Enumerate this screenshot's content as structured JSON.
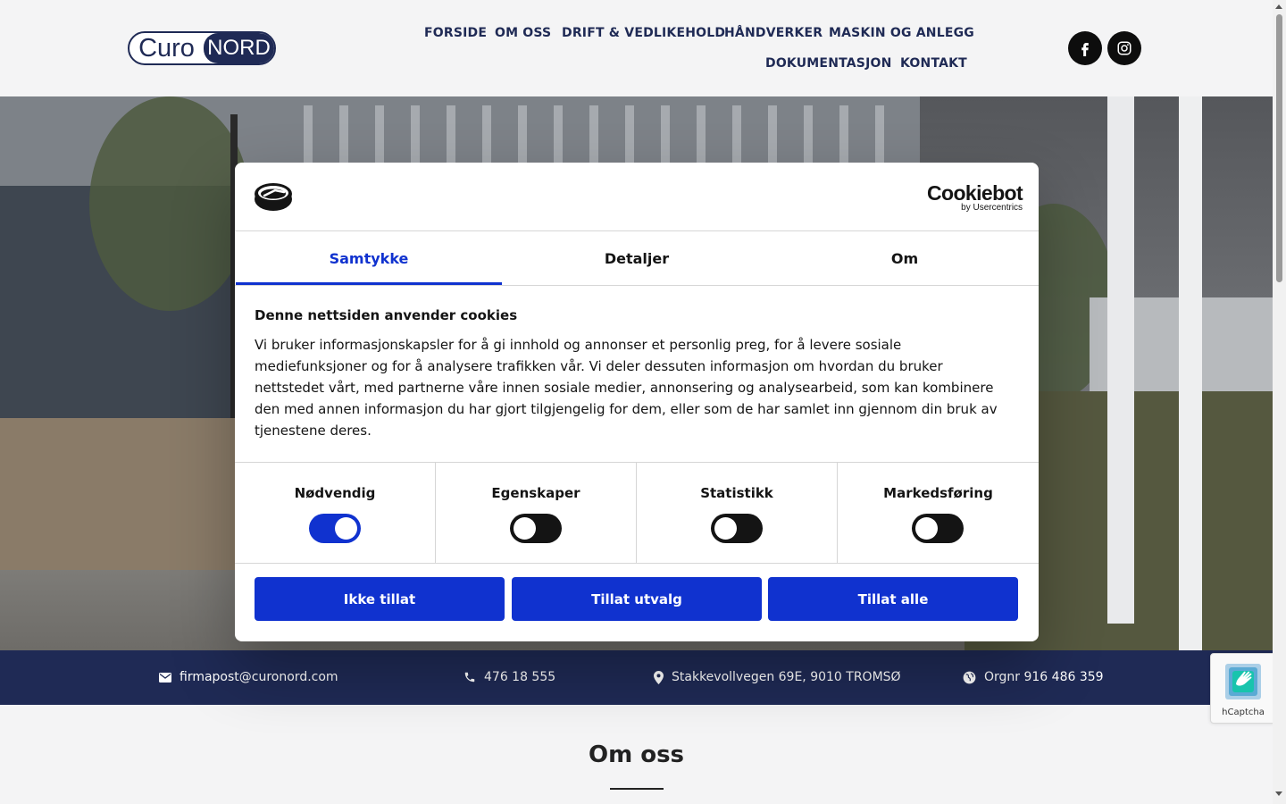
{
  "header": {
    "logo": {
      "part1": "Curo",
      "part2": "NORD"
    },
    "nav": [
      {
        "label": "FORSIDE"
      },
      {
        "label": "OM OSS"
      },
      {
        "label": "DRIFT & VEDLIKEHOLD"
      },
      {
        "label": "HÅNDVERKER"
      },
      {
        "label": "MASKIN OG ANLEGG"
      },
      {
        "label": "DOKUMENTASJON"
      },
      {
        "label": "KONTAKT"
      }
    ],
    "social": [
      {
        "icon": "facebook-icon"
      },
      {
        "icon": "instagram-icon"
      }
    ]
  },
  "infobar": {
    "email": "firmapost@curonord.com",
    "phone": "476 18 555",
    "address": "Stakkevollvegen 69E, 9010 TROMSØ",
    "orgnr": "Orgnr 916 486 359"
  },
  "section": {
    "title": "Om oss"
  },
  "hcaptcha": {
    "label": "hCaptcha"
  },
  "cookie_dialog": {
    "brand": {
      "name": "Cookiebot",
      "by": "by Usercentrics"
    },
    "tabs": [
      {
        "label": "Samtykke",
        "active": true
      },
      {
        "label": "Detaljer",
        "active": false
      },
      {
        "label": "Om",
        "active": false
      }
    ],
    "heading": "Denne nettsiden anvender cookies",
    "body": "Vi bruker informasjonskapsler for å gi innhold og annonser et personlig preg, for å levere sosiale mediefunksjoner og for å analysere trafikken vår. Vi deler dessuten informasjon om hvordan du bruker nettstedet vårt, med partnerne våre innen sosiale medier, annonsering og analysearbeid, som kan kombinere den med annen informasjon du har gjort tilgjengelig for dem, eller som de har samlet inn gjennom din bruk av tjenestene deres.",
    "categories": [
      {
        "label": "Nødvendig",
        "enabled": true
      },
      {
        "label": "Egenskaper",
        "enabled": false
      },
      {
        "label": "Statistikk",
        "enabled": false
      },
      {
        "label": "Markedsføring",
        "enabled": false
      }
    ],
    "buttons": {
      "deny": "Ikke tillat",
      "selection": "Tillat utvalg",
      "all": "Tillat alle"
    }
  },
  "colors": {
    "brand_navy": "#1f2a55",
    "cookiebot_blue": "#1032cf",
    "text_dark": "#141414"
  }
}
